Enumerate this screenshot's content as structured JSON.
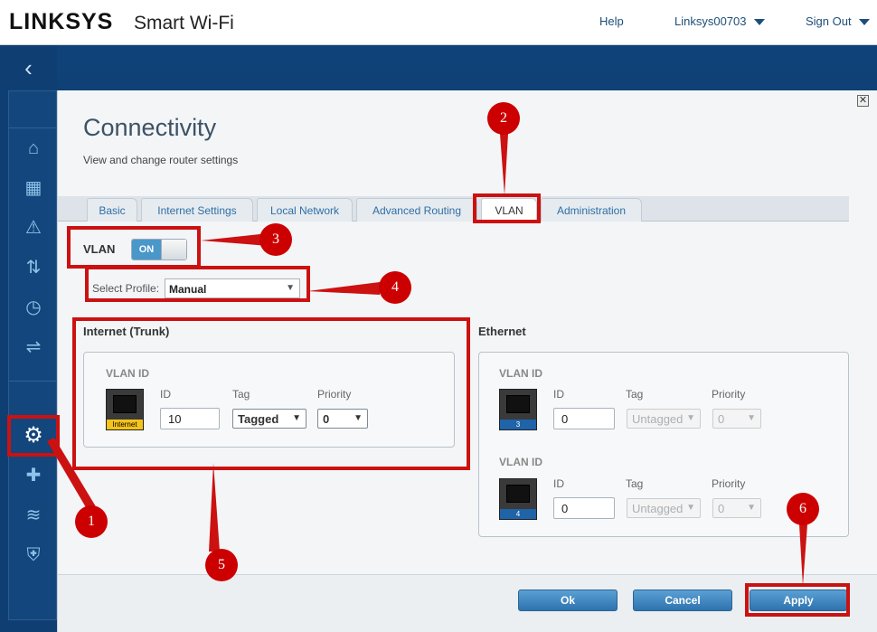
{
  "header": {
    "brand": "LINKSYS",
    "product": "Smart Wi-Fi",
    "help": "Help",
    "account": "Linksys00703",
    "sign_out": "Sign Out"
  },
  "sidebar": {
    "back": "‹",
    "icons": [
      "router-icon",
      "calendar-icon",
      "warning-icon",
      "device-prioritization-icon",
      "speed-test-icon",
      "usb-storage-icon",
      "settings-gear-icon",
      "troubleshooting-icon",
      "wifi-settings-icon",
      "security-icon"
    ]
  },
  "dialog": {
    "title": "Connectivity",
    "subtitle": "View and change router settings",
    "close": "✕",
    "tabs": [
      {
        "label": "Basic"
      },
      {
        "label": "Internet Settings"
      },
      {
        "label": "Local Network"
      },
      {
        "label": "Advanced Routing"
      },
      {
        "label": "VLAN"
      },
      {
        "label": "Administration"
      }
    ],
    "active_tab": "VLAN",
    "vlan_label": "VLAN",
    "vlan_toggle": "ON",
    "profile_label": "Select Profile:",
    "profile_value": "Manual",
    "internet": {
      "heading": "Internet (Trunk)",
      "vlan_id_label": "VLAN ID",
      "port_label": "Internet",
      "col_id": "ID",
      "col_tag": "Tag",
      "col_priority": "Priority",
      "id_value": "10",
      "tag_value": "Tagged",
      "priority_value": "0"
    },
    "ethernet": {
      "heading": "Ethernet",
      "ports": [
        {
          "vlan_id_label": "VLAN ID",
          "port_label": "3",
          "col_id": "ID",
          "col_tag": "Tag",
          "col_priority": "Priority",
          "id_value": "0",
          "tag_value": "Untagged",
          "priority_value": "0"
        },
        {
          "vlan_id_label": "VLAN ID",
          "port_label": "4",
          "col_id": "ID",
          "col_tag": "Tag",
          "col_priority": "Priority",
          "id_value": "0",
          "tag_value": "Untagged",
          "priority_value": "0"
        }
      ]
    },
    "buttons": {
      "ok": "Ok",
      "cancel": "Cancel",
      "apply": "Apply"
    }
  },
  "annotations": [
    "1",
    "2",
    "3",
    "4",
    "5",
    "6"
  ],
  "colors": {
    "highlight": "#cc1111",
    "accent": "#2e73ae",
    "brand_bg": "#0f3e72"
  }
}
